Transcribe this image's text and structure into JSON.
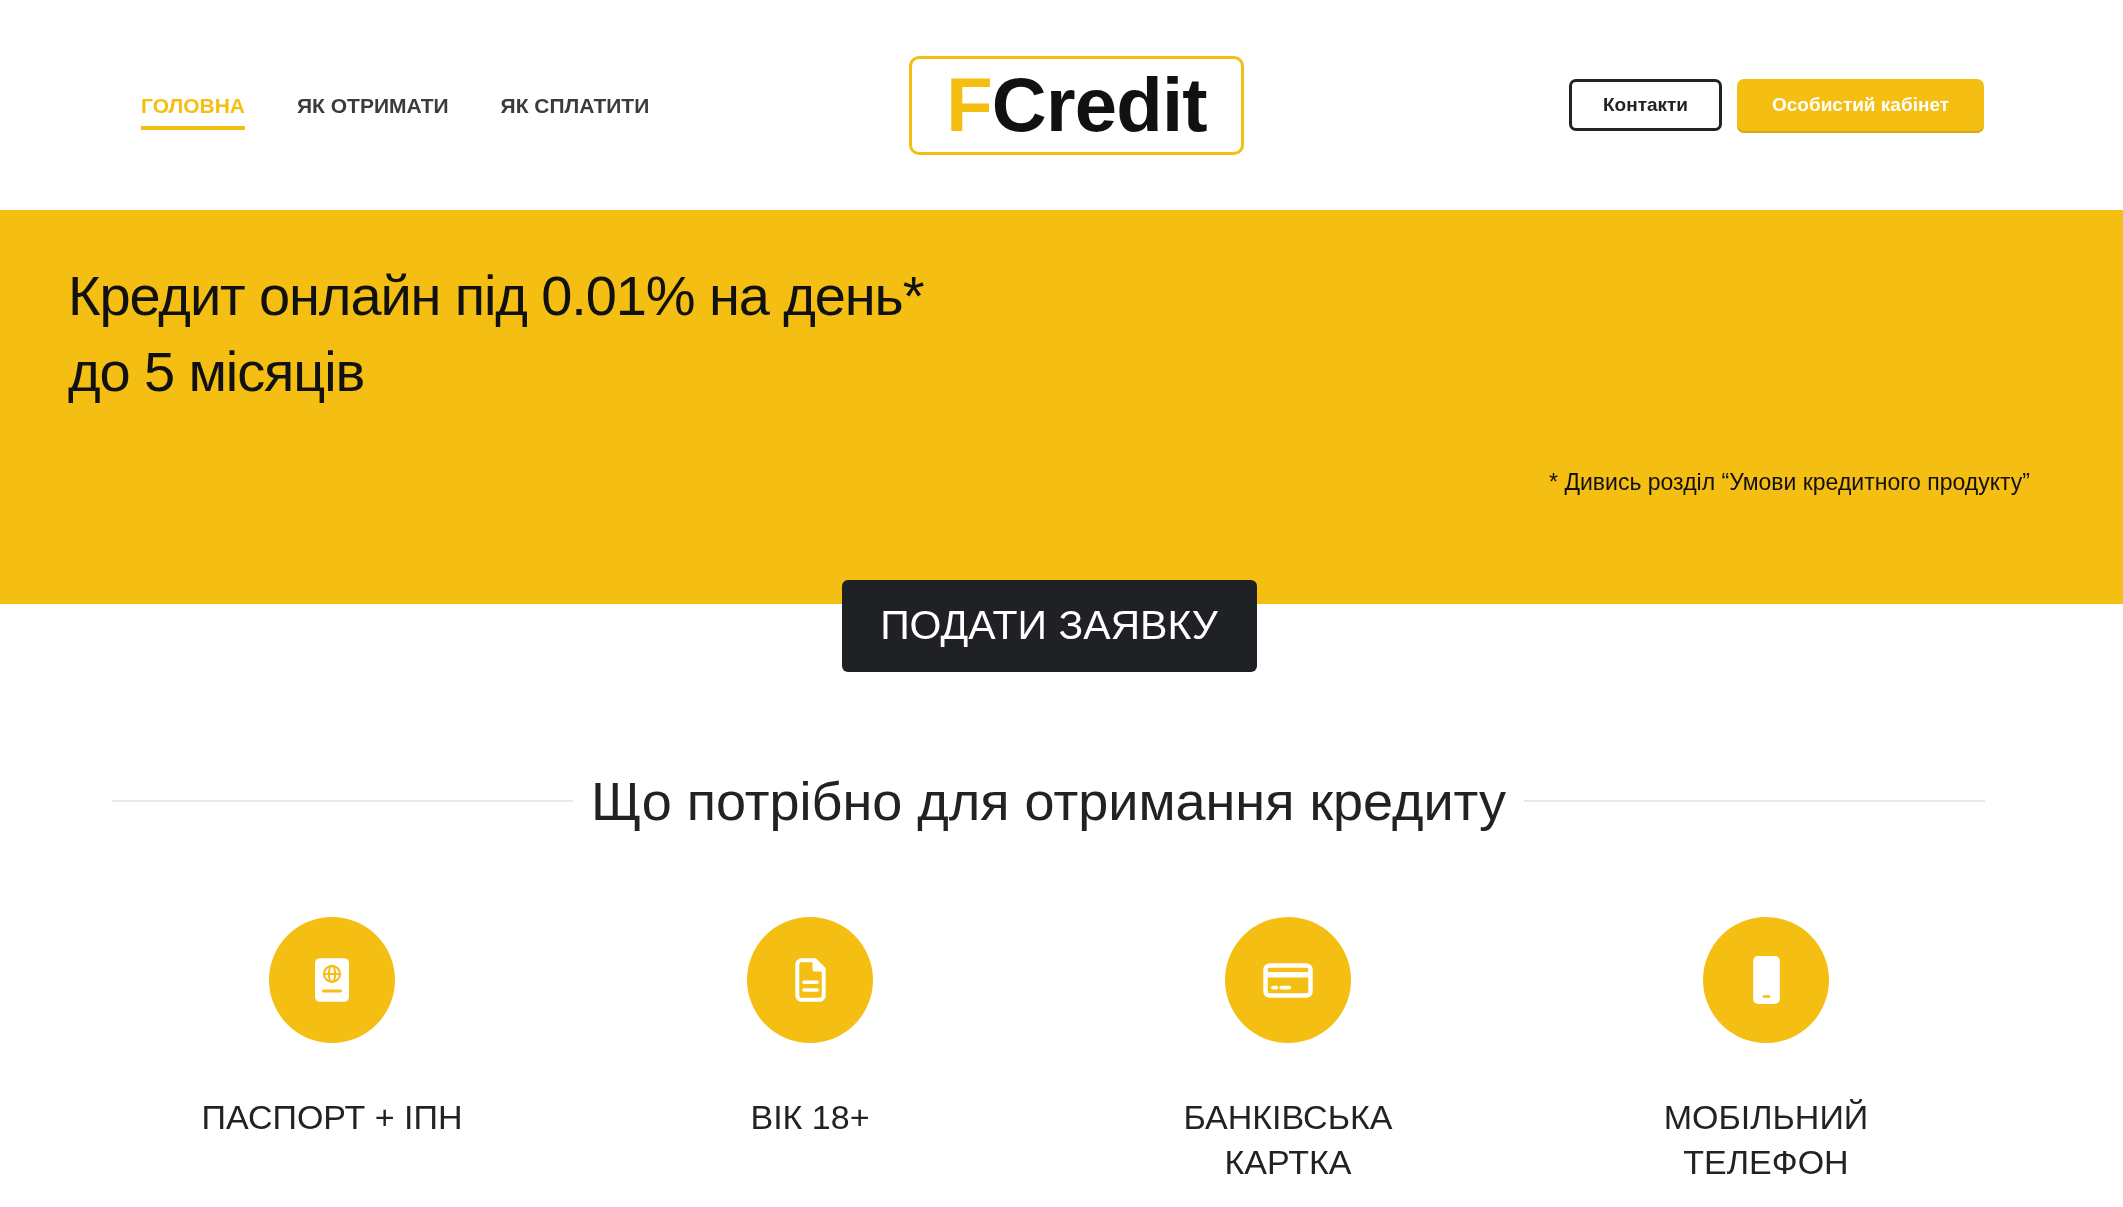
{
  "nav": {
    "items": [
      {
        "label": "ГОЛОВНА",
        "selected": true
      },
      {
        "label": "ЯК ОТРИМАТИ",
        "selected": false
      },
      {
        "label": "ЯК СПЛАТИТИ",
        "selected": false
      }
    ]
  },
  "logo": {
    "accent": "F",
    "text": "Credit"
  },
  "header_buttons": [
    {
      "label": "Контакти",
      "kind": "outline"
    },
    {
      "label": "Особистий кабінет",
      "kind": "filled"
    }
  ],
  "hero": {
    "title_lines": [
      "Кредит онлайн під 0.01% на день*",
      "до 5 місяців"
    ],
    "footnote": "* Дивись розділ “Умови кредитного продукту”"
  },
  "cta_button": {
    "label": "ПОДАТИ ЗАЯВКУ"
  },
  "requirements": {
    "heading": "Що потрібно для отримання кредиту",
    "items": [
      {
        "kind": "passport",
        "label": "ПАСПОРТ + ІПН"
      },
      {
        "kind": "document",
        "label": "ВІК 18+"
      },
      {
        "kind": "card",
        "label": "БАНКІВСЬКА КАРТКА"
      },
      {
        "kind": "phone",
        "label": "МОБІЛЬНИЙ ТЕЛЕФОН"
      }
    ]
  }
}
